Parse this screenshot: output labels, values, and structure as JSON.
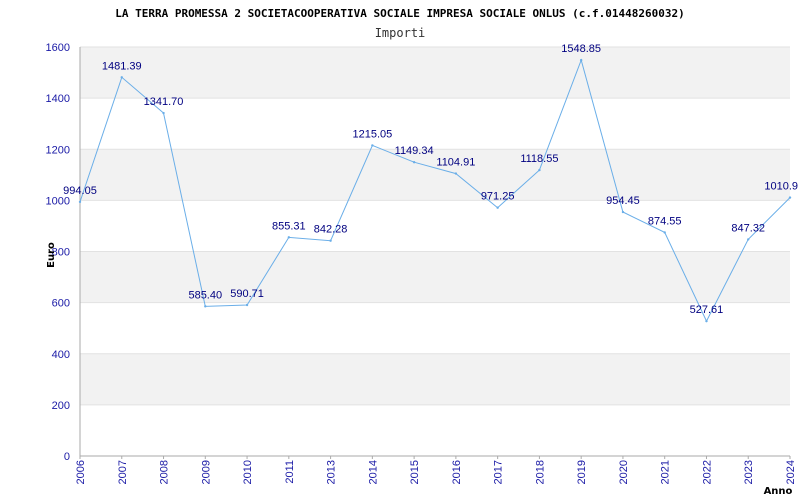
{
  "chart_data": {
    "type": "line",
    "title": "LA TERRA PROMESSA 2 SOCIETACOOPERATIVA SOCIALE IMPRESA SOCIALE ONLUS (c.f.01448260032)",
    "subtitle": "Importi",
    "xlabel": "Anno",
    "ylabel": "Euro",
    "ylim": [
      0,
      1600
    ],
    "yticks": [
      0,
      200,
      400,
      600,
      800,
      1000,
      1200,
      1400,
      1600
    ],
    "grid": true,
    "series": [
      {
        "x": [
          "2006",
          "2007",
          "2008",
          "2009",
          "2010",
          "2011",
          "2013",
          "2014",
          "2015",
          "2016",
          "2017",
          "2018",
          "2019",
          "2020",
          "2021",
          "2022",
          "2023",
          "2024"
        ],
        "values": [
          994.05,
          1481.39,
          1341.7,
          585.4,
          590.71,
          855.31,
          842.28,
          1215.05,
          1149.34,
          1104.91,
          971.25,
          1118.55,
          1548.85,
          954.45,
          874.55,
          527.61,
          847.32,
          1010.9
        ],
        "labels": [
          "994.05",
          "1481.39",
          "1341.70",
          "585.40",
          "590.71",
          "855.31",
          "842.28",
          "1215.05",
          "1149.34",
          "1104.91",
          "971.25",
          "1118.55",
          "1548.85",
          "954.45",
          "874.55",
          "527.61",
          "847.32",
          "1010.9"
        ],
        "color": "#6aaee8"
      }
    ]
  },
  "colors": {
    "band": "#f2f2f2",
    "axis": "#aaaaaa",
    "line": "#6aaee8",
    "tick_text": "#1a1aa6",
    "label_text": "#000080"
  }
}
